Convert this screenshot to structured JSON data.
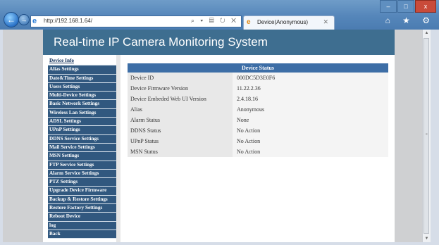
{
  "browser": {
    "url": "http://192.168.1.64/",
    "address_tools": "⌕ ▾ ▤ ↻ ✕",
    "tab_title": "Device(Anonymous)",
    "tab_close": "✕",
    "window_buttons": [
      "–",
      "□",
      "x"
    ],
    "toolbar_icons": "⌂ ★ ⚙"
  },
  "page": {
    "title": "Real-time IP Camera Monitoring System"
  },
  "menu": {
    "items": [
      "Device Info",
      "Alias Settings",
      "Date&Time Settings",
      "Users Settings",
      "Multi-Device Settings",
      "Basic Network Settings",
      "Wireless Lan Settings",
      "ADSL Settings",
      "UPnP Settings",
      "DDNS Service Settings",
      "Mail Service Settings",
      "MSN Settings",
      "FTP Service Settings",
      "Alarm Service Settings",
      "PTZ Settings",
      "Upgrade Device Firmware",
      "Backup & Restore Settings",
      "Restore Factory Settings",
      "Reboot Device",
      "log",
      "Back"
    ]
  },
  "status": {
    "header": "Device Status",
    "rows": [
      {
        "label": "Device ID",
        "value": "000DC5D3E0F6"
      },
      {
        "label": "Device Firmware Version",
        "value": "11.22.2.36"
      },
      {
        "label": "Device Embeded Web UI Version",
        "value": "2.4.18.16"
      },
      {
        "label": "Alias",
        "value": "Anonymous"
      },
      {
        "label": "Alarm Status",
        "value": "None"
      },
      {
        "label": "DDNS Status",
        "value": "No Action"
      },
      {
        "label": "UPnP Status",
        "value": "No Action"
      },
      {
        "label": "MSN Status",
        "value": "No Action"
      }
    ]
  },
  "colors": {
    "banner": "#3e6e90",
    "menu_bg": "#31587f",
    "table_header": "#3d6ea6"
  }
}
